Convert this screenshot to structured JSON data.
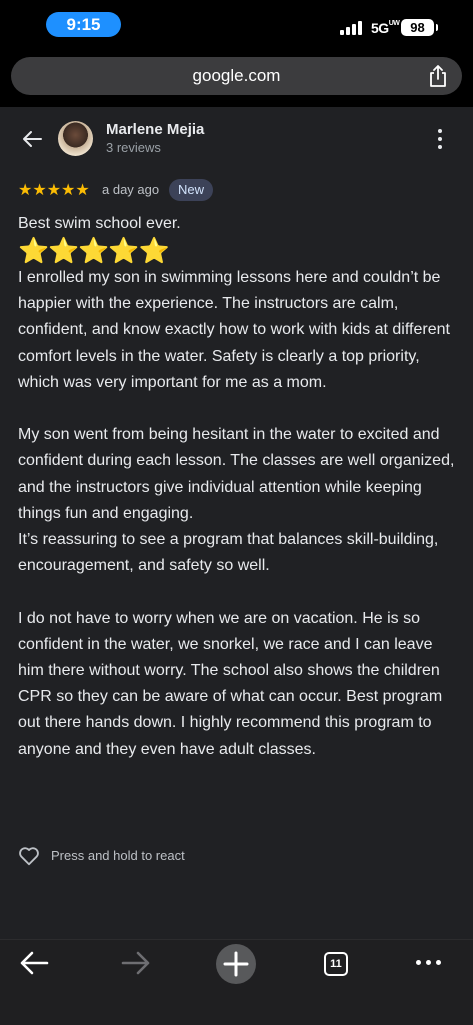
{
  "status_bar": {
    "time": "9:15",
    "network": "5G",
    "network_super": "UW",
    "battery": "98"
  },
  "url_bar": {
    "url": "google.com",
    "share_icon": "share-icon"
  },
  "review": {
    "reviewer_name": "Marlene Mejia",
    "reviewer_meta": "3 reviews",
    "rating": 5,
    "stars": "★★★★★",
    "posted": "a day ago",
    "badge": "New",
    "title": "Best swim school ever.",
    "emoji_stars": "⭐⭐⭐⭐⭐",
    "paragraphs": [
      "I enrolled my son in swimming lessons here and couldn’t be happier with the experience. The instructors are calm, confident, and know exactly how to work with kids at different comfort levels in the water. Safety is clearly a top priority, which was very important for me as a mom.",
      "My son went from being hesitant in the water to excited and confident during each lesson. The classes are well organized, and the instructors give individual attention while keeping things fun and engaging.",
      "It’s reassuring to see a program that balances skill-building, encouragement, and safety so well.",
      "I do not have to worry when we are on vacation. He is so confident in the water, we snorkel, we race and I can leave him there without worry. The school also shows the children CPR so they can be aware of what can occur. Best program out there hands down. I highly recommend this program to anyone and they even have adult classes."
    ],
    "react_label": "Press and hold to react"
  },
  "toolbar": {
    "open_tabs": "11"
  },
  "colors": {
    "accent_time": "#1e90ff",
    "star": "#fbbc04",
    "content_bg": "#202124",
    "badge_bg": "#3c4258"
  }
}
